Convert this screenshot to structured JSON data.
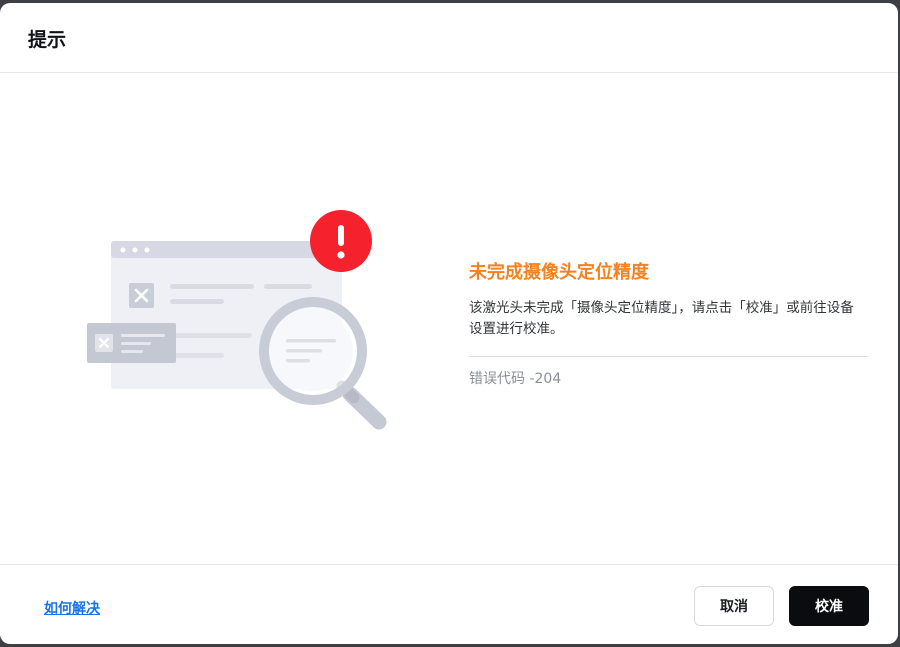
{
  "dialog": {
    "title": "提示"
  },
  "error": {
    "title": "未完成摄像头定位精度",
    "message": "该激光头未完成「摄像头定位精度」，请点击「校准」或前往设备设置进行校准。",
    "code": "错误代码 -204"
  },
  "footer": {
    "help_link": "如何解决",
    "cancel_label": "取消",
    "calibrate_label": "校准"
  },
  "colors": {
    "accent_orange": "#f58220",
    "alert_red": "#f5222d",
    "link_blue": "#1a73e8",
    "primary_button": "#0b0c10"
  },
  "icons": {
    "alert": "exclamation-icon",
    "search": "magnifier-icon",
    "error_card": "close-x-icon"
  }
}
